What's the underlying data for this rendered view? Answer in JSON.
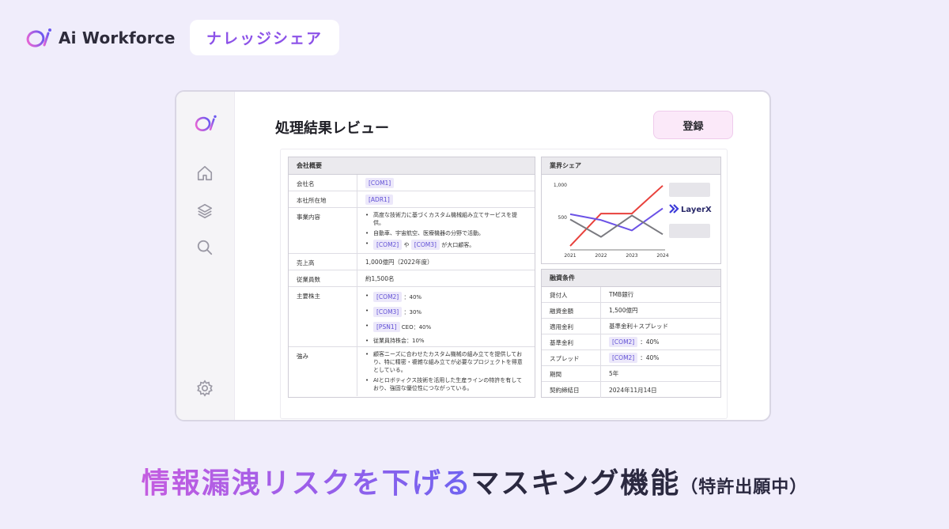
{
  "brand": {
    "name": "Ai Workforce"
  },
  "tag": {
    "label": "ナレッジシェア"
  },
  "app": {
    "title": "処理結果レビュー",
    "register_label": "登録",
    "nav_icons": [
      "home-icon",
      "layers-icon",
      "search-icon",
      "settings-icon"
    ]
  },
  "company": {
    "header": "会社概要",
    "name_label": "会社名",
    "name_value": "[COM1]",
    "address_label": "本社所在地",
    "address_value": "[ADR1]",
    "business_label": "事業内容",
    "business_items": [
      "高度な技術力に基づくカスタム機械組み立てサービスを提供。",
      "自動車、宇宙航空、医療機器の分野で活動。"
    ],
    "business_chip1": "[COM2]",
    "business_mid": "や",
    "business_chip2": "[COM3]",
    "business_tail": "が大口顧客。",
    "sales_label": "売上高",
    "sales_value": "1,000億円（2022年度）",
    "employees_label": "従業員数",
    "employees_value": "約1,500名",
    "shareholders_label": "主要株主",
    "sh1_chip": "[COM2]",
    "sh1_text": "：40%",
    "sh2_chip": "[COM3]",
    "sh2_text": "：30%",
    "sh3_chip": "[PSN1]",
    "sh3_text": "CEO：40%",
    "sh4_text": "従業員持株会：10%",
    "strength_label": "強み",
    "strength_items": [
      "顧客ニーズに合わせたカスタム機械の組み立てを提供しており、特に精密・複雑な組み立てが必要なプロジェクトを得意としている。",
      "AIとロボティクス技術を活用した生産ラインの特許を有しており、強固な優位性につながっている。"
    ]
  },
  "share": {
    "header": "業界シェア",
    "logo_text": "LayerX"
  },
  "chart_data": {
    "type": "line",
    "x": [
      "2021",
      "2022",
      "2023",
      "2024"
    ],
    "yticks": [
      "1,000",
      "500",
      "0"
    ],
    "ylim": [
      0,
      1000
    ],
    "series": [
      {
        "values": [
          60,
          560,
          560,
          990
        ],
        "color": "#e8413c"
      },
      {
        "values": [
          550,
          460,
          300,
          640
        ],
        "color": "#6b52e6"
      },
      {
        "values": [
          470,
          200,
          530,
          240
        ],
        "color": "#7a7a80"
      }
    ]
  },
  "loan": {
    "header": "融資条件",
    "rows": [
      {
        "label": "貸付人",
        "value": "TMB銀行"
      },
      {
        "label": "融資金額",
        "value": "1,500億円"
      },
      {
        "label": "適用金利",
        "value": "基準金利＋スプレッド"
      },
      {
        "label": "基準金利",
        "chip": "[COM2]",
        "value": "：40%"
      },
      {
        "label": "スプレッド",
        "chip": "[COM2]",
        "value": "：40%"
      },
      {
        "label": "期間",
        "value": "5年"
      },
      {
        "label": "契約締結日",
        "value": "2024年11月14日"
      }
    ]
  },
  "footer": {
    "highlight": "情報漏洩リスクを下げる",
    "main": "マスキング機能",
    "note": "（特許出願中）"
  },
  "colors": {
    "accent": "#8c52e8",
    "background": "#f0edfb"
  }
}
